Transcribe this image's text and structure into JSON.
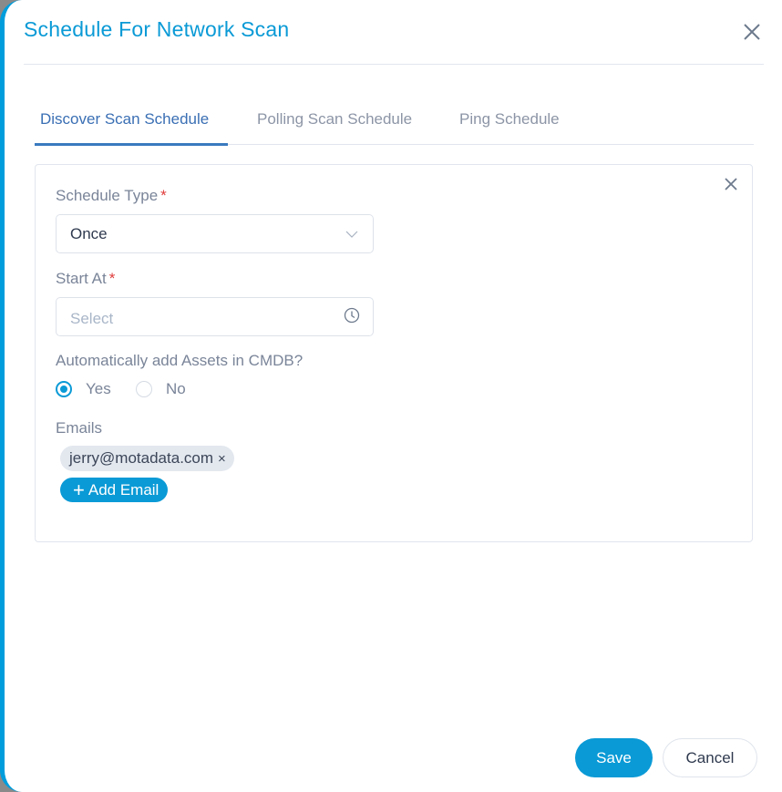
{
  "modal": {
    "title": "Schedule For Network Scan",
    "close_icon": "close-icon"
  },
  "tabs": [
    {
      "label": "Discover Scan Schedule",
      "active": true
    },
    {
      "label": "Polling Scan Schedule",
      "active": false
    },
    {
      "label": "Ping Schedule",
      "active": false
    }
  ],
  "form": {
    "schedule_type": {
      "label": "Schedule Type",
      "required_mark": "*",
      "value": "Once"
    },
    "start_at": {
      "label": "Start At",
      "required_mark": "*",
      "placeholder": "Select"
    },
    "auto_add_assets": {
      "label": "Automatically add Assets in CMDB?",
      "options": [
        {
          "label": "Yes",
          "checked": true
        },
        {
          "label": "No",
          "checked": false
        }
      ]
    },
    "emails": {
      "label": "Emails",
      "items": [
        {
          "value": "jerry@motadata.com",
          "remove": "×"
        }
      ],
      "add_button": {
        "icon": "+",
        "label": "Add Email"
      }
    }
  },
  "footer": {
    "save_label": "Save",
    "cancel_label": "Cancel"
  },
  "colors": {
    "accent": "#0a9ad6",
    "tab_active": "#3a6fb4",
    "required": "#e03c3c"
  }
}
